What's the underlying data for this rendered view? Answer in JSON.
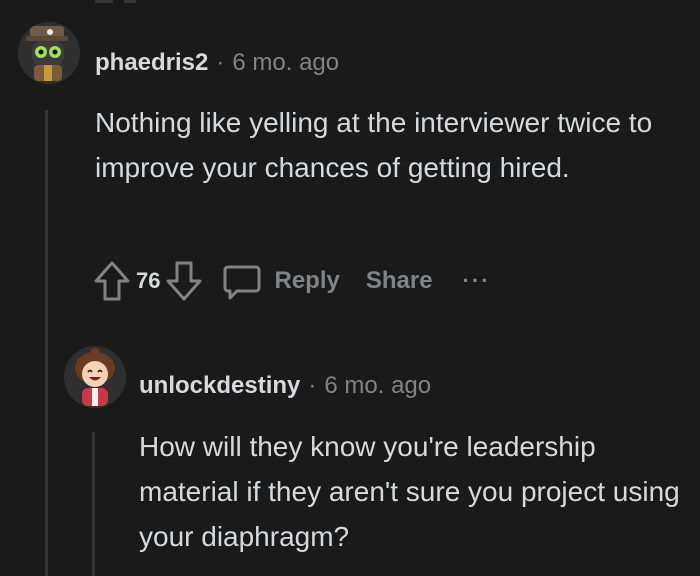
{
  "comments": [
    {
      "username": "phaedris2",
      "separator": "·",
      "time": "6 mo. ago",
      "body": "Nothing like yelling at the interviewer twice to improve your chances of getting hired.",
      "votes": "76",
      "actions": {
        "reply": "Reply",
        "share": "Share",
        "more": "···"
      },
      "avatar_icon": "robot-goggles-avatar"
    },
    {
      "username": "unlockdestiny",
      "separator": "·",
      "time": "6 mo. ago",
      "body": "How will they know you're leadership material if they aren't sure you project using your diaphragm?",
      "avatar_icon": "smiling-girl-avatar"
    }
  ],
  "colors": {
    "background": "#1a1a1b",
    "text": "#d7dadc",
    "muted": "#818384",
    "thread_line": "#343536"
  }
}
